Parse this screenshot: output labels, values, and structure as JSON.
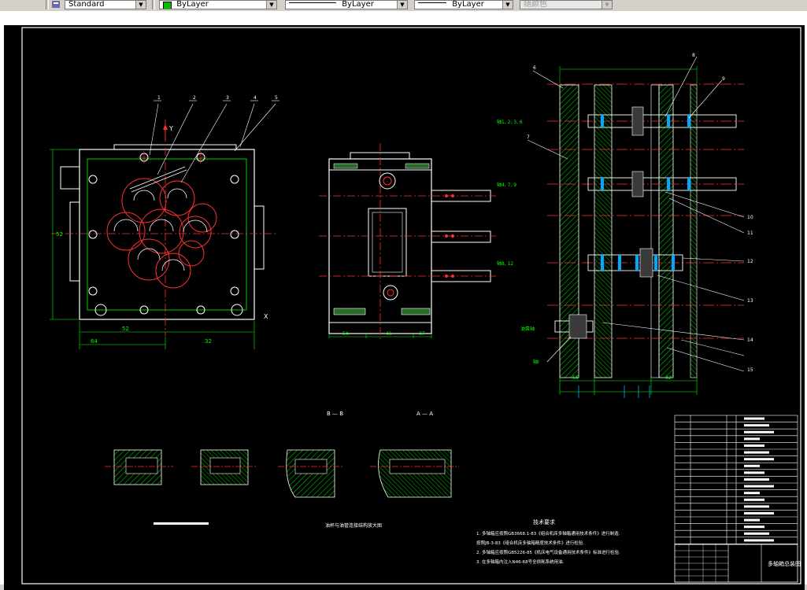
{
  "toolbar": {
    "textstyle_value": "Standard",
    "layer_value": "ByLayer",
    "linetype_value": "ByLayer",
    "lineweight_value": "ByLayer",
    "plotstyle_value": "随颜色"
  },
  "drawing": {
    "section_b": "B — B",
    "section_a": "A — A",
    "tech_title": "技术要求",
    "tech_notes": [
      "1. 多轴箱应按照GB3668.1-83《组合机床多轴箱通用技术条件》进行制造.",
      "   按照JB-3-83《组合机床多轴箱精度技术条件》进行检验.",
      "2. 多轴箱应按照GB5226-85《机床电气设备通用技术条件》标准进行检验.",
      "3. 在多轴箱内注入N46-68号全损耗系统用油."
    ],
    "title_block_name": "多轴箱总装图",
    "section_caption": "油杯与油管连接结构放大图",
    "x_axis_label": "X",
    "y_axis_label": "Y",
    "dims": {
      "plan_width": "52",
      "plan_height": "52",
      "front_a": "54",
      "front_b": "41",
      "front_c": "37",
      "side_a": "56",
      "side_b": "32",
      "plan_left": "64",
      "plan_bottom": "32"
    },
    "callouts": [
      "1",
      "2",
      "3",
      "4",
      "5",
      "6",
      "7",
      "8",
      "9",
      "10",
      "11",
      "12",
      "13",
      "14",
      "15"
    ],
    "side_labels": [
      "轴1, 2, 3, 6",
      "轴4, 7, 9",
      "轴8, 12",
      "油泵轴",
      "轴I"
    ]
  }
}
